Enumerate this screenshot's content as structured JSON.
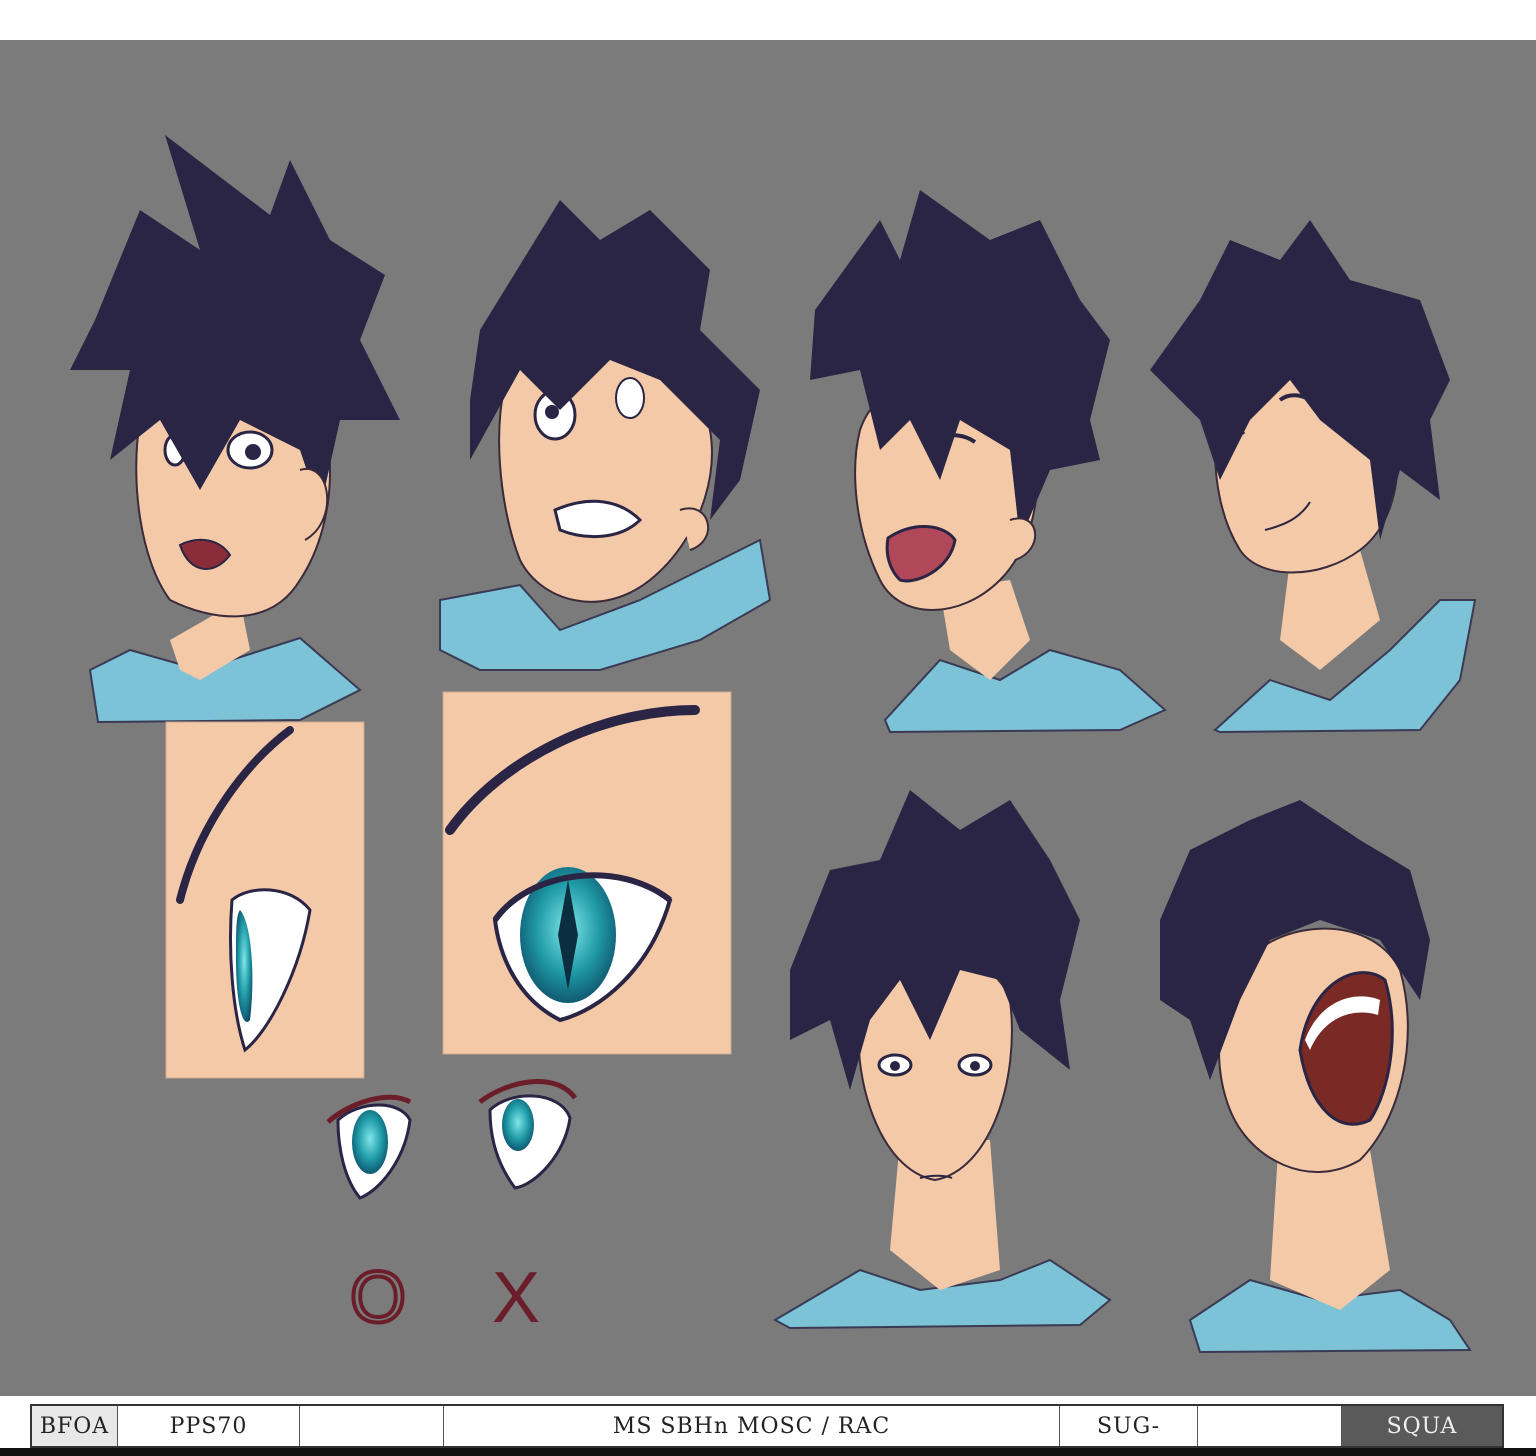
{
  "colors": {
    "background": "#7b7b7b",
    "hair": "#2a2445",
    "skin": "#f4c9a8",
    "shirt": "#7cc3d8",
    "iris": "#1f9aa6",
    "mark": "#6b1e2a"
  },
  "marks": {
    "circle": "O",
    "cross": "X"
  },
  "footer": {
    "cells": [
      "BFOA",
      "PPS70",
      "",
      "MS SBHn  MOSC / RAC",
      "SUG-",
      "",
      "SQUA"
    ]
  }
}
